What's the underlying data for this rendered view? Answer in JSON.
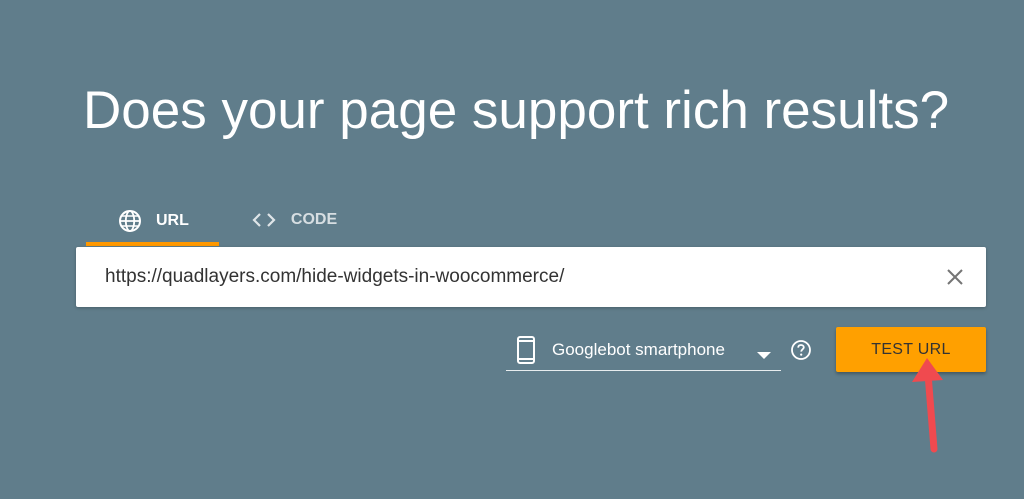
{
  "headline": "Does your page support rich results?",
  "tabs": [
    {
      "label": "URL",
      "icon": "globe-icon",
      "active": true
    },
    {
      "label": "CODE",
      "icon": "code-brackets-icon",
      "active": false
    }
  ],
  "url_input": {
    "value": "https://quadlayers.com/hide-widgets-in-woocommerce/"
  },
  "device_select": {
    "selected": "Googlebot smartphone",
    "icon": "smartphone-icon"
  },
  "test_button": {
    "label": "TEST URL"
  },
  "colors": {
    "background": "#607d8b",
    "accent": "#ff9800",
    "button": "#ffa000",
    "annotation_arrow": "#f04a4f"
  }
}
